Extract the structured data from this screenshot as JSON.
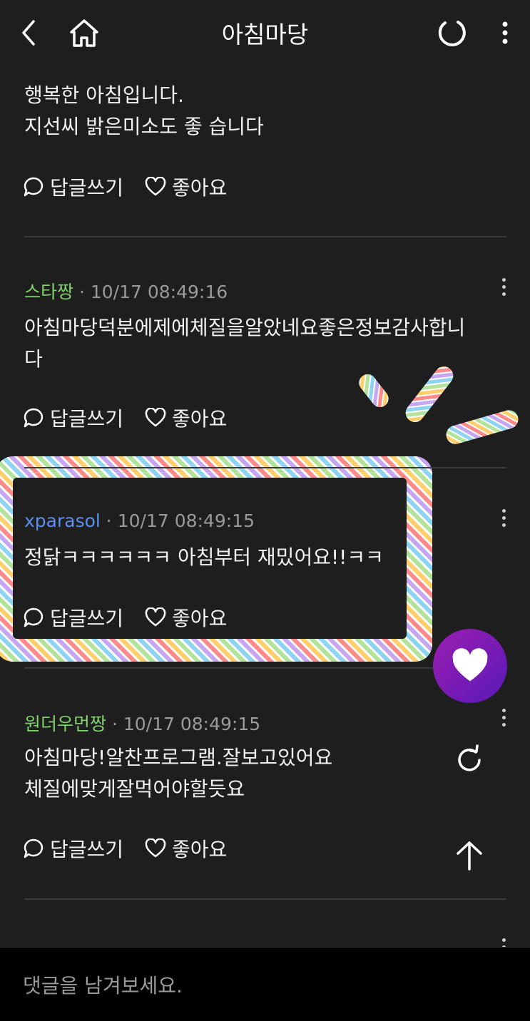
{
  "header": {
    "title": "아침마당",
    "icons": [
      "back-icon",
      "home-icon",
      "refresh-icon",
      "more-vertical-icon"
    ]
  },
  "comments": [
    {
      "author": "",
      "time": "",
      "text": "행복한 아침입니다.\n지선씨 밝은미소도 좋 습니다",
      "reply_label": "답글쓰기",
      "like_label": "좋아요"
    },
    {
      "author": "스타짱",
      "time": "10/17 08:49:16",
      "text": "아침마당덕분에제에체질을알았네요좋은정보감사합니\n다",
      "reply_label": "답글쓰기",
      "like_label": "좋아요"
    },
    {
      "author": "xparasol",
      "time": "10/17 08:49:15",
      "text": "정닭ㅋㅋㅋㅋㅋㅋ 아침부터 재밌어요!!ㅋㅋ",
      "reply_label": "답글쓰기",
      "like_label": "좋아요"
    },
    {
      "author": "원더우먼짱",
      "time": "10/17 08:49:15",
      "text": "아침마당!알찬프로그램.잘보고있어요\n체질에맞게잘먹어야할듯요",
      "reply_label": "답글쓰기",
      "like_label": "좋아요"
    }
  ],
  "comment_input": {
    "placeholder": "댓글을 남겨보세요."
  },
  "colors": {
    "background": "#1e1e1e",
    "author_green": "#7fd16a",
    "author_blue": "#5b8ff0",
    "fab_gradient_start": "#9b1fb0",
    "fab_gradient_end": "#5a18b8"
  }
}
